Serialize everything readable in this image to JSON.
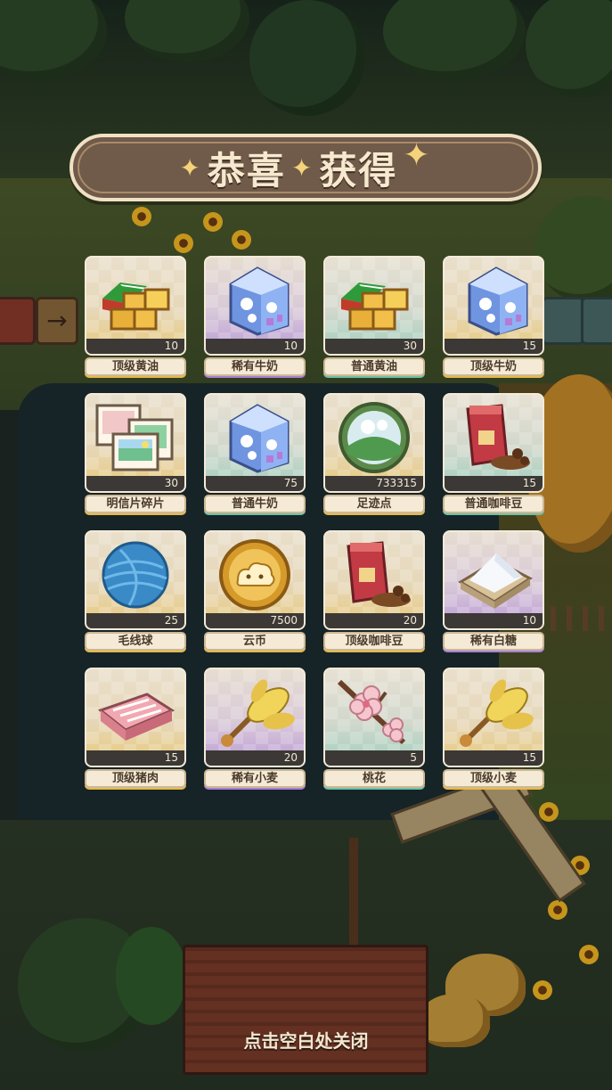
{
  "title": {
    "left": "恭喜",
    "right": "获得"
  },
  "rewards": [
    {
      "name": "顶级黄油",
      "count": "10",
      "icon": "butter-icon",
      "rarity": "gold"
    },
    {
      "name": "稀有牛奶",
      "count": "10",
      "icon": "milk-carton-icon",
      "rarity": "purple"
    },
    {
      "name": "普通黄油",
      "count": "30",
      "icon": "butter-icon",
      "rarity": "teal"
    },
    {
      "name": "顶级牛奶",
      "count": "15",
      "icon": "milk-carton-icon",
      "rarity": "gold"
    },
    {
      "name": "明信片碎片",
      "count": "30",
      "icon": "postcard-icon",
      "rarity": "gold"
    },
    {
      "name": "普通牛奶",
      "count": "75",
      "icon": "milk-carton-icon",
      "rarity": "teal"
    },
    {
      "name": "足迹点",
      "count": "733315",
      "icon": "footprint-orb-icon",
      "rarity": "gold"
    },
    {
      "name": "普通咖啡豆",
      "count": "15",
      "icon": "coffee-bag-icon",
      "rarity": "teal"
    },
    {
      "name": "毛线球",
      "count": "25",
      "icon": "yarn-ball-icon",
      "rarity": "gold"
    },
    {
      "name": "云币",
      "count": "7500",
      "icon": "cloud-coin-icon",
      "rarity": "gold"
    },
    {
      "name": "顶级咖啡豆",
      "count": "20",
      "icon": "coffee-bag-icon",
      "rarity": "gold"
    },
    {
      "name": "稀有白糖",
      "count": "10",
      "icon": "sugar-tray-icon",
      "rarity": "purple"
    },
    {
      "name": "顶级猪肉",
      "count": "15",
      "icon": "pork-icon",
      "rarity": "gold"
    },
    {
      "name": "稀有小麦",
      "count": "20",
      "icon": "wheat-icon",
      "rarity": "purple"
    },
    {
      "name": "桃花",
      "count": "5",
      "icon": "peach-blossom-icon",
      "rarity": "teal"
    },
    {
      "name": "顶级小麦",
      "count": "15",
      "icon": "wheat-icon",
      "rarity": "gold"
    }
  ],
  "close_hint": "点击空白处关闭",
  "colors": {
    "banner": "#705a49",
    "banner_text": "#f7e9cf",
    "rarity_gold": "#e6b94a",
    "rarity_purple": "#a67fd8",
    "rarity_teal": "#6cc0a8"
  }
}
